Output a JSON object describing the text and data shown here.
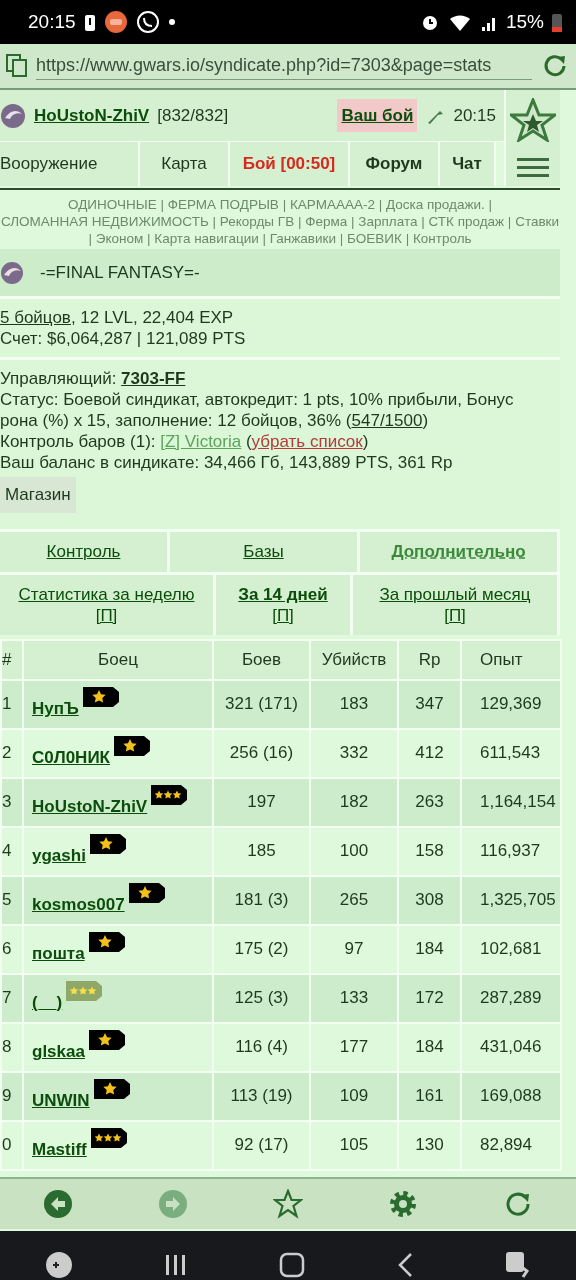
{
  "status_bar": {
    "time": "20:15",
    "battery": "15%"
  },
  "address_bar": {
    "url": "https://www.gwars.io/syndicate.php?id=7303&page=stats"
  },
  "header": {
    "player": "HoUstoN-ZhiV",
    "hp": "[832/832]",
    "battle_button": "Ваш бой",
    "time": "20:15"
  },
  "nav": [
    {
      "label": "Вооружение",
      "kind": "normal"
    },
    {
      "label": "Карта",
      "kind": "normal"
    },
    {
      "label": "Бой [00:50]",
      "kind": "alert"
    },
    {
      "label": "Форум",
      "kind": "bold"
    },
    {
      "label": "Чат",
      "kind": "bold"
    }
  ],
  "quick_links": {
    "separator": "|",
    "items": [
      "ОДИНОЧНЫЕ",
      "ФЕРМА ПОДРЫВ",
      "КАРМАААА-2",
      "Доска продажи.",
      "СЛОМАННАЯ НЕДВИЖИМОСТЬ",
      "Рекорды ГВ",
      "Ферма",
      "Зарплата",
      "СТК продаж",
      "Ставки",
      "Эконом",
      "Карта навигации",
      "Ганжавики",
      "БОЕВИК",
      "Контроль"
    ]
  },
  "syndicate": {
    "name": "-=FINAL FANTASY=-"
  },
  "summary": [
    [
      {
        "text": "5 бойцов",
        "kind": "link"
      },
      {
        "text": ", 12 LVL, 22,404 EXP",
        "kind": "plain"
      }
    ],
    [
      {
        "text": "Счет: $6,064,287 | 121,089 PTS",
        "kind": "plain"
      }
    ]
  ],
  "details": [
    [
      {
        "text": "Управляющий: ",
        "kind": "plain"
      },
      {
        "text": "7303-FF",
        "kind": "bold-link"
      }
    ],
    [
      {
        "text": "Статус: Боевой синдикат, автокредит: 1 pts, 10% прибыли, Бонус",
        "kind": "plain"
      }
    ],
    [
      {
        "text": "рона (%) x 15, заполнение: 12 бойцов, 36% (",
        "kind": "plain"
      },
      {
        "text": "547/1500",
        "kind": "link"
      },
      {
        "text": ")",
        "kind": "plain"
      }
    ],
    [
      {
        "text": "Контроль баров (1): ",
        "kind": "plain"
      },
      {
        "text": "[Z] Victoria",
        "kind": "pale-link"
      },
      {
        "text": " (",
        "kind": "plain"
      },
      {
        "text": "убрать список",
        "kind": "red-link"
      },
      {
        "text": ")",
        "kind": "plain"
      }
    ],
    [
      {
        "text": "Ваш баланс в синдикате: 34,466 Гб, 143,889 PTS, 361 Rp",
        "kind": "plain"
      }
    ]
  ],
  "shop_button": "Магазин",
  "tabs": [
    {
      "label": "Контроль",
      "selected": false
    },
    {
      "label": "Базы",
      "selected": false
    },
    {
      "label": "Дополнительно",
      "selected": true
    }
  ],
  "periods": [
    {
      "label": "Статистика за неделю",
      "suffix": "[П]",
      "selected": false
    },
    {
      "label": "За 14 дней",
      "suffix": "[П]",
      "selected": true
    },
    {
      "label": "За прошлый месяц",
      "suffix": "[П]",
      "selected": false
    }
  ],
  "table": {
    "columns": [
      "#",
      "Боец",
      "Боев",
      "Убийств",
      "Rp",
      "Опыт"
    ],
    "rows": [
      {
        "rank": "1",
        "name": "НупЪ",
        "kind": "one-star",
        "battles": "321 (171)",
        "kills": "183",
        "rp": "347",
        "exp": "129,369"
      },
      {
        "rank": "2",
        "name": "С0Л0НИК",
        "kind": "one-star",
        "battles": "256 (16)",
        "kills": "332",
        "rp": "412",
        "exp": "611,543"
      },
      {
        "rank": "3",
        "name": "HoUstoN-ZhiV",
        "kind": "three-star",
        "battles": "197",
        "kills": "182",
        "rp": "263",
        "exp": "1,164,154"
      },
      {
        "rank": "4",
        "name": "ygashi",
        "kind": "one-star",
        "battles": "185",
        "kills": "100",
        "rp": "158",
        "exp": "116,937"
      },
      {
        "rank": "5",
        "name": "kosmos007",
        "kind": "one-star",
        "battles": "181 (3)",
        "kills": "265",
        "rp": "308",
        "exp": "1,325,705"
      },
      {
        "rank": "6",
        "name": "пошта",
        "kind": "one-star",
        "battles": "175 (2)",
        "kills": "97",
        "rp": "184",
        "exp": "102,681"
      },
      {
        "rank": "7",
        "name": "(__)",
        "kind": "three-star-green",
        "battles": "125 (3)",
        "kills": "133",
        "rp": "172",
        "exp": "287,289"
      },
      {
        "rank": "8",
        "name": "glskaa",
        "kind": "one-star",
        "battles": "116 (4)",
        "kills": "177",
        "rp": "184",
        "exp": "431,046"
      },
      {
        "rank": "9",
        "name": "UNWIN",
        "kind": "one-star",
        "battles": "113 (19)",
        "kills": "109",
        "rp": "161",
        "exp": "169,088"
      },
      {
        "rank": "0",
        "name": "Mastiff",
        "kind": "three-star",
        "battles": "92 (17)",
        "kills": "105",
        "rp": "130",
        "exp": "82,894"
      }
    ]
  },
  "toolbar": [
    {
      "kind": "back",
      "disabled": false
    },
    {
      "kind": "forward",
      "disabled": true
    },
    {
      "kind": "bookmark",
      "disabled": false
    },
    {
      "kind": "settings",
      "disabled": false
    },
    {
      "kind": "reload",
      "disabled": false
    }
  ]
}
